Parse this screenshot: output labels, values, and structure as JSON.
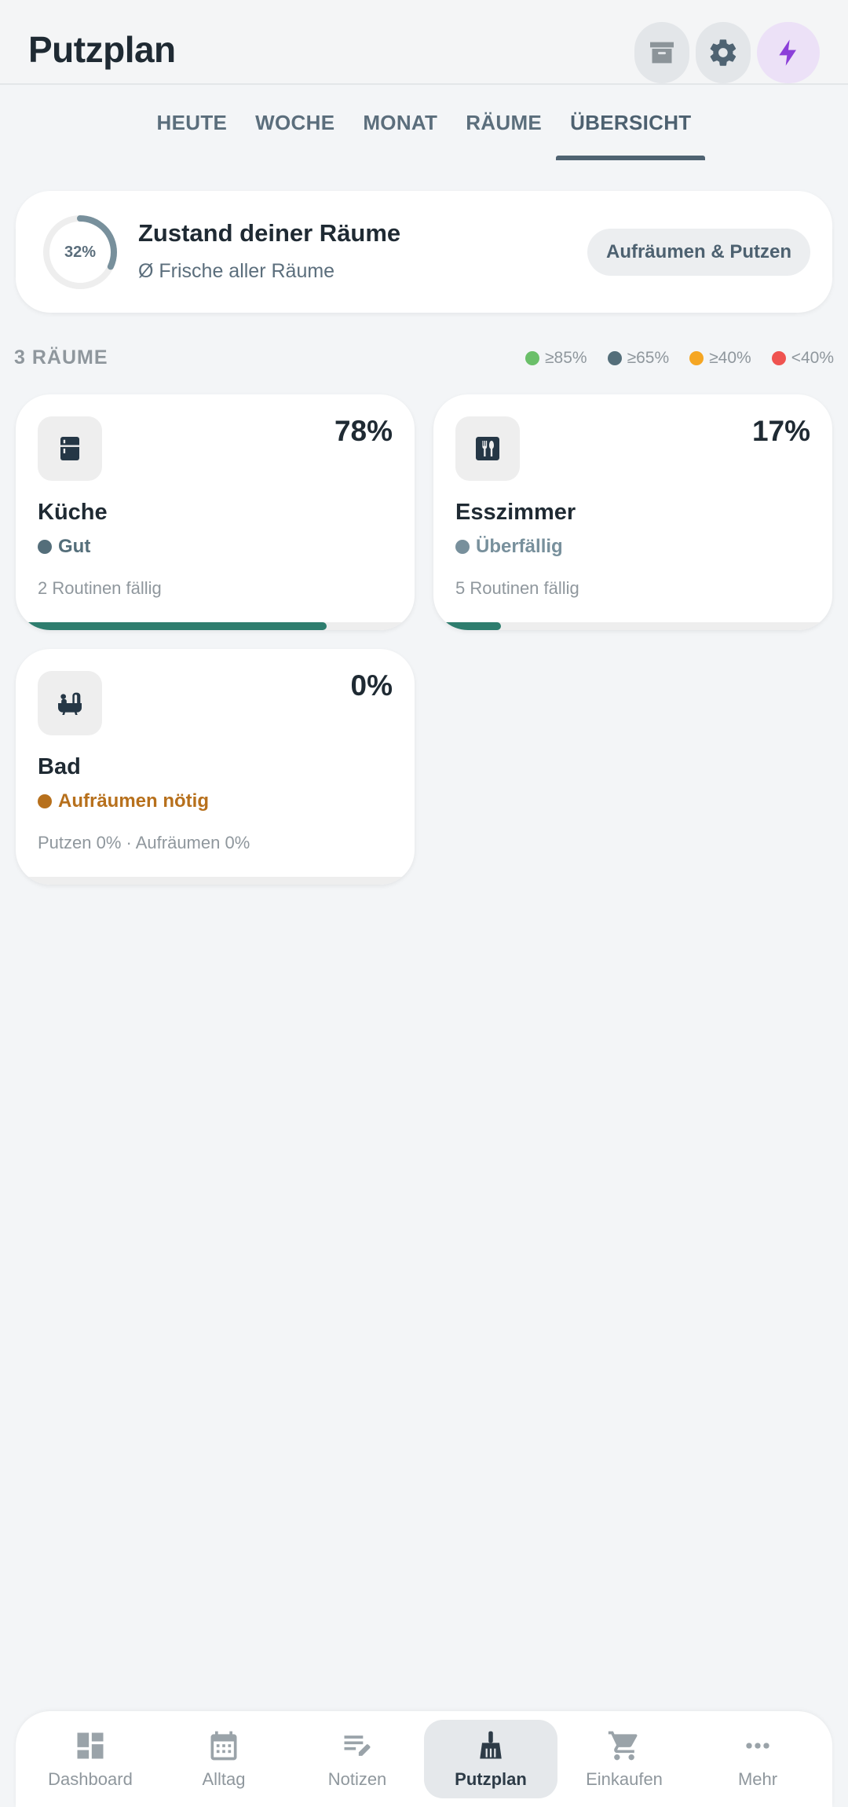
{
  "header": {
    "title": "Putzplan",
    "buttons": [
      {
        "name": "archive-button",
        "icon": "archive-icon"
      },
      {
        "name": "settings-button",
        "icon": "gear-icon"
      },
      {
        "name": "quick-action-button",
        "icon": "bolt-icon",
        "color": "#8b3fd9"
      }
    ]
  },
  "tabs": [
    {
      "label": "HEUTE",
      "active": false
    },
    {
      "label": "WOCHE",
      "active": false
    },
    {
      "label": "MONAT",
      "active": false
    },
    {
      "label": "RÄUME",
      "active": false
    },
    {
      "label": "ÜBERSICHT",
      "active": true
    }
  ],
  "summary": {
    "percent_label": "32%",
    "percent_value": 32,
    "title": "Zustand deiner Räume",
    "subtitle": "Ø Frische aller Räume",
    "button_label": "Aufräumen & Putzen"
  },
  "rooms_section": {
    "count_label": "3 RÄUME",
    "legend": [
      {
        "label": "≥85%",
        "color": "#6abf69"
      },
      {
        "label": "≥65%",
        "color": "#546e7a"
      },
      {
        "label": "≥40%",
        "color": "#f5a623"
      },
      {
        "label": "<40%",
        "color": "#ef5350"
      }
    ]
  },
  "rooms": [
    {
      "name": "Küche",
      "percent_label": "78%",
      "percent_value": 78,
      "status": "Gut",
      "status_color": "#546e7a",
      "status_text_color": "#546e7a",
      "detail": "2 Routinen fällig",
      "icon": "fridge-icon"
    },
    {
      "name": "Esszimmer",
      "percent_label": "17%",
      "percent_value": 17,
      "status": "Überfällig",
      "status_color": "#78909c",
      "status_text_color": "#78909c",
      "detail": "5 Routinen fällig",
      "icon": "cutlery-icon"
    },
    {
      "name": "Bad",
      "percent_label": "0%",
      "percent_value": 0,
      "status": "Aufräumen nötig",
      "status_color": "#b7701c",
      "status_text_color": "#b7701c",
      "detail": "Putzen 0% · Aufräumen 0%",
      "icon": "bathtub-icon"
    }
  ],
  "bottom_nav": [
    {
      "label": "Dashboard",
      "icon": "dashboard-icon",
      "active": false
    },
    {
      "label": "Alltag",
      "icon": "calendar-icon",
      "active": false
    },
    {
      "label": "Notizen",
      "icon": "notes-icon",
      "active": false
    },
    {
      "label": "Putzplan",
      "icon": "broom-icon",
      "active": true
    },
    {
      "label": "Einkaufen",
      "icon": "cart-icon",
      "active": false
    },
    {
      "label": "Mehr",
      "icon": "more-icon",
      "active": false
    }
  ]
}
